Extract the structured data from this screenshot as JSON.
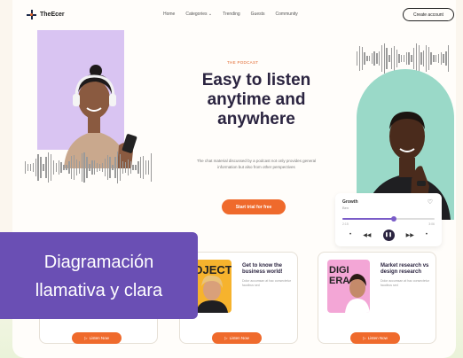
{
  "nav": {
    "brand": "TheEcer",
    "menu": [
      "Home",
      "Categories ⌄",
      "Trending",
      "Guests",
      "Community"
    ],
    "cta": "Create account"
  },
  "hero": {
    "kicker": "THE PODCAST",
    "headline_lines": [
      "Easy to listen",
      "anytime and",
      "anywhere"
    ],
    "sub": "The chat material discussed by a podcast not only provides general information but also from other perspectives",
    "button": "Start trial for free"
  },
  "player": {
    "title": "Growth",
    "subtitle": "Ben",
    "time_elapsed": "2:15",
    "time_total": "3:06",
    "progress": 0.56
  },
  "cards": [
    {
      "title": "",
      "desc": "",
      "button": "Listen Now",
      "thumb_text": ""
    },
    {
      "title": "Get to know the business world!",
      "desc": "Dolor accumsan at hac consectetur faucibus sed",
      "button": "Listen Now",
      "thumb_text": "ROJECT"
    },
    {
      "title": "Market research vs design research",
      "desc": "Dolor accumsan at hac consectetur faucibus sed",
      "button": "Listen Now",
      "thumb_text": "DIGI ERA"
    }
  ],
  "overlay": {
    "lines": [
      "Diagramación",
      "llamativa y clara"
    ]
  },
  "colors": {
    "accent": "#ef6a2c",
    "headline": "#2b2440",
    "lilac": "#d9c4f2",
    "mint": "#9ad9c8",
    "overlay": "#6a4fb4"
  }
}
